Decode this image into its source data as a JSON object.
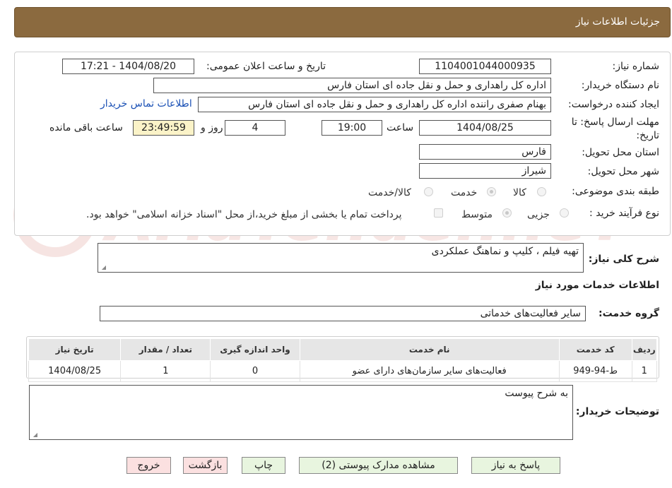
{
  "header": {
    "title": "جزئیات اطلاعات نیاز"
  },
  "form": {
    "need_number_label": "شماره نیاز:",
    "need_number": "1104001044000935",
    "announce_label": "تاریخ و ساعت اعلان عمومی:",
    "announce_value": "1404/08/20 - 17:21",
    "buyer_label": "نام دستگاه خریدار:",
    "buyer_value": "اداره کل راهداری و حمل و نقل جاده ای استان فارس",
    "creator_label": "ایجاد کننده درخواست:",
    "creator_value": "بهنام صفری راننده اداره کل راهداری و حمل و نقل جاده ای استان فارس",
    "contact_link": "اطلاعات تماس خریدار",
    "deadline_label_line1": "مهلت ارسال پاسخ: تا",
    "deadline_label_line2": "تاریخ:",
    "deadline_date": "1404/08/25",
    "time_label": "ساعت",
    "deadline_time": "19:00",
    "days_value": "4",
    "days_label": "روز و",
    "remaining_time": "23:49:59",
    "remaining_label": "ساعت باقی مانده",
    "province_label": "استان محل تحویل:",
    "province_value": "فارس",
    "city_label": "شهر محل تحویل:",
    "city_value": "شیراز",
    "category_label": "طبقه بندی موضوعی:",
    "category_options": [
      "کالا",
      "خدمت",
      "کالا/خدمت"
    ],
    "process_label": "نوع فرآیند خرید :",
    "process_options": [
      "جزیی",
      "متوسط"
    ],
    "payment_note": "پرداخت تمام یا بخشی از مبلغ خرید،از محل \"اسناد خزانه اسلامی\" خواهد بود."
  },
  "description": {
    "label": "شرح کلی نیاز:",
    "value": "تهیه فیلم ، کلیپ و نماهنگ عملکردی"
  },
  "services": {
    "section_title": "اطلاعات خدمات مورد نیاز",
    "group_label": "گروه خدمت:",
    "group_value": "سایر فعالیت‌های خدماتی",
    "table": {
      "headers": [
        "ردیف",
        "کد خدمت",
        "نام خدمت",
        "واحد اندازه گیری",
        "تعداد / مقدار",
        "تاریخ نیاز"
      ],
      "rows": [
        [
          "1",
          "ط-94-949",
          "فعالیت‌های سایر سازمان‌های دارای عضو",
          "0",
          "1",
          "1404/08/25"
        ]
      ]
    }
  },
  "buyer_notes": {
    "label": "توضیحات خریدار:",
    "value": "به شرح پیوست"
  },
  "buttons": {
    "reply": "پاسخ به نیاز",
    "attachments": "مشاهده مدارک پیوستی (2)",
    "print": "چاپ",
    "back": "بازگشت",
    "exit": "خروج"
  },
  "watermark": {
    "text": "AriaTender.neT"
  }
}
